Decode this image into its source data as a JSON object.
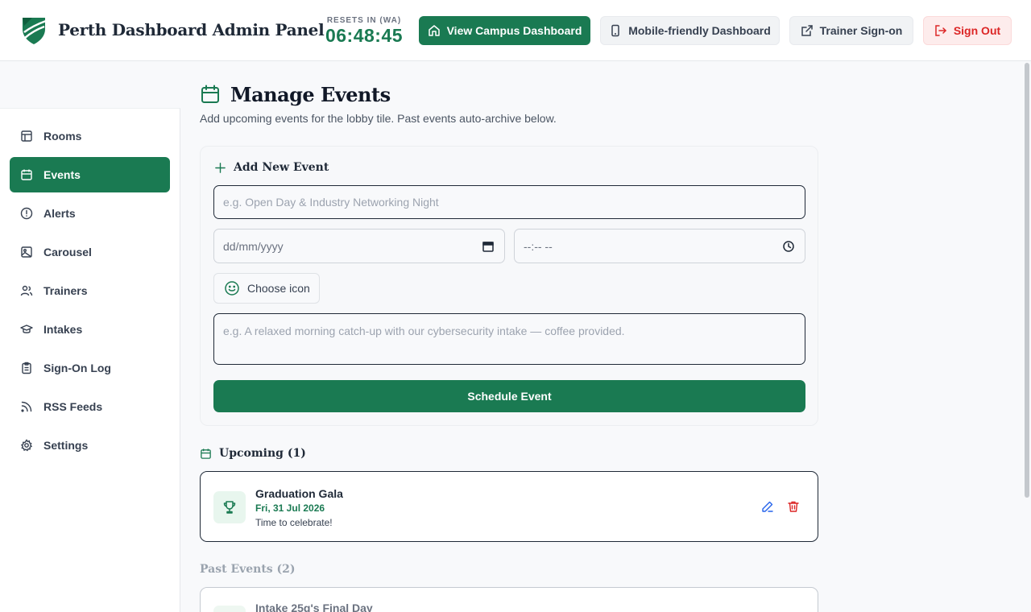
{
  "header": {
    "app_title": "Perth Dashboard Admin Panel",
    "timer_label": "RESETS IN (WA)",
    "timer_value": "06:48:45",
    "buttons": {
      "campus": "View Campus Dashboard",
      "mobile": "Mobile-friendly Dashboard",
      "trainer": "Trainer Sign-on",
      "signout": "Sign Out"
    }
  },
  "sidebar": {
    "items": [
      {
        "label": "Rooms",
        "icon": "layout-icon"
      },
      {
        "label": "Events",
        "icon": "calendar-icon",
        "active": true
      },
      {
        "label": "Alerts",
        "icon": "alert-circle-icon"
      },
      {
        "label": "Carousel",
        "icon": "image-icon"
      },
      {
        "label": "Trainers",
        "icon": "users-icon"
      },
      {
        "label": "Intakes",
        "icon": "graduation-cap-icon"
      },
      {
        "label": "Sign-On Log",
        "icon": "clipboard-icon"
      },
      {
        "label": "RSS Feeds",
        "icon": "rss-icon"
      },
      {
        "label": "Settings",
        "icon": "gear-icon"
      }
    ]
  },
  "main": {
    "title": "Manage Events",
    "subtitle": "Add upcoming events for the lobby tile. Past events auto-archive below.",
    "form": {
      "heading": "Add New Event",
      "title_placeholder": "e.g. Open Day & Industry Networking Night",
      "date_placeholder": "dd/mm/yyyy",
      "time_placeholder": "--:-- --",
      "choose_icon_label": "Choose icon",
      "description_placeholder": "e.g. A relaxed morning catch-up with our cybersecurity intake — coffee provided.",
      "submit_label": "Schedule Event"
    },
    "upcoming": {
      "heading": "Upcoming (1)",
      "events": [
        {
          "name": "Graduation Gala",
          "date": "Fri, 31 Jul 2026",
          "description": "Time to celebrate!",
          "icon": "trophy-icon"
        }
      ]
    },
    "past": {
      "heading": "Past Events (2)",
      "events": [
        {
          "name": "Intake 25g's Final Day"
        }
      ]
    }
  },
  "colors": {
    "brand": "#1a7a52",
    "danger": "#dc2626",
    "edit": "#2563eb"
  }
}
